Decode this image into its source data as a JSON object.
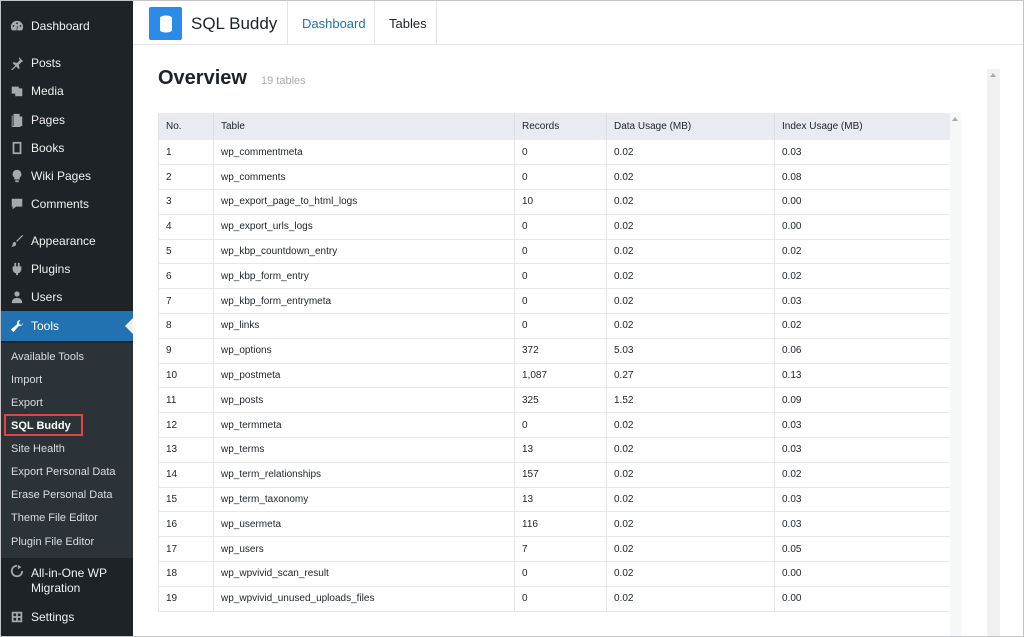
{
  "sidebar": {
    "items": [
      {
        "label": "Dashboard",
        "icon": "dashboard-icon"
      },
      {
        "label": "Posts",
        "icon": "pushpin-icon"
      },
      {
        "label": "Media",
        "icon": "media-icon"
      },
      {
        "label": "Pages",
        "icon": "pages-icon"
      },
      {
        "label": "Books",
        "icon": "book-icon"
      },
      {
        "label": "Wiki Pages",
        "icon": "lightbulb-icon"
      },
      {
        "label": "Comments",
        "icon": "comment-icon"
      },
      {
        "label": "Appearance",
        "icon": "paintbrush-icon"
      },
      {
        "label": "Plugins",
        "icon": "plug-icon"
      },
      {
        "label": "Users",
        "icon": "user-icon"
      },
      {
        "label": "Tools",
        "icon": "wrench-icon"
      },
      {
        "label": "All-in-One WP Migration",
        "icon": "migration-icon"
      },
      {
        "label": "Settings",
        "icon": "settings-icon"
      }
    ],
    "submenu": [
      "Available Tools",
      "Import",
      "Export",
      "SQL Buddy",
      "Site Health",
      "Export Personal Data",
      "Erase Personal Data",
      "Theme File Editor",
      "Plugin File Editor"
    ]
  },
  "header": {
    "app_title": "SQL Buddy",
    "tabs": [
      "Dashboard",
      "Tables"
    ]
  },
  "main": {
    "title": "Overview",
    "count": "19 tables",
    "columns": [
      "No.",
      "Table",
      "Records",
      "Data Usage (MB)",
      "Index Usage (MB)"
    ],
    "rows": [
      [
        "1",
        "wp_commentmeta",
        "0",
        "0.02",
        "0.03"
      ],
      [
        "2",
        "wp_comments",
        "0",
        "0.02",
        "0.08"
      ],
      [
        "3",
        "wp_export_page_to_html_logs",
        "10",
        "0.02",
        "0.00"
      ],
      [
        "4",
        "wp_export_urls_logs",
        "0",
        "0.02",
        "0.00"
      ],
      [
        "5",
        "wp_kbp_countdown_entry",
        "0",
        "0.02",
        "0.02"
      ],
      [
        "6",
        "wp_kbp_form_entry",
        "0",
        "0.02",
        "0.02"
      ],
      [
        "7",
        "wp_kbp_form_entrymeta",
        "0",
        "0.02",
        "0.03"
      ],
      [
        "8",
        "wp_links",
        "0",
        "0.02",
        "0.02"
      ],
      [
        "9",
        "wp_options",
        "372",
        "5.03",
        "0.06"
      ],
      [
        "10",
        "wp_postmeta",
        "1,087",
        "0.27",
        "0.13"
      ],
      [
        "11",
        "wp_posts",
        "325",
        "1.52",
        "0.09"
      ],
      [
        "12",
        "wp_termmeta",
        "0",
        "0.02",
        "0.03"
      ],
      [
        "13",
        "wp_terms",
        "13",
        "0.02",
        "0.03"
      ],
      [
        "14",
        "wp_term_relationships",
        "157",
        "0.02",
        "0.02"
      ],
      [
        "15",
        "wp_term_taxonomy",
        "13",
        "0.02",
        "0.03"
      ],
      [
        "16",
        "wp_usermeta",
        "116",
        "0.02",
        "0.03"
      ],
      [
        "17",
        "wp_users",
        "7",
        "0.02",
        "0.05"
      ],
      [
        "18",
        "wp_wpvivid_scan_result",
        "0",
        "0.02",
        "0.00"
      ],
      [
        "19",
        "wp_wpvivid_unused_uploads_files",
        "0",
        "0.02",
        "0.00"
      ]
    ]
  },
  "colors": {
    "sidebar_bg": "#1d2327",
    "submenu_bg": "#2c3338",
    "active_bg": "#2271b1",
    "accent": "#2a8ce8",
    "highlight": "#e0463f"
  }
}
